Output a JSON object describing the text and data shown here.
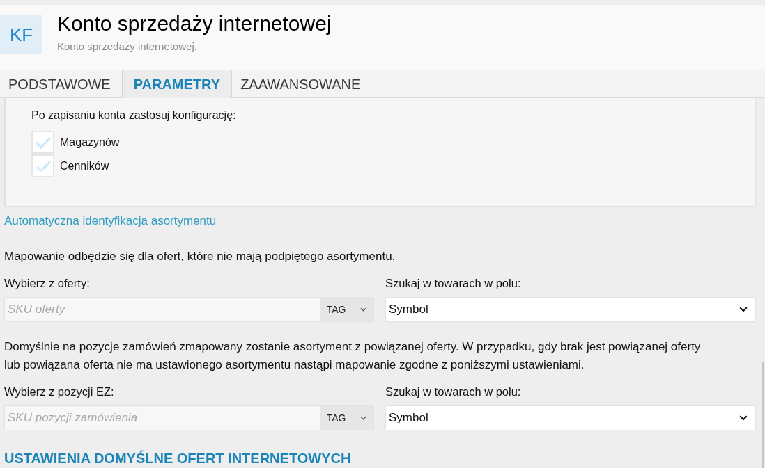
{
  "header": {
    "logo_text": "KF",
    "title": "Konto sprzedaży internetowej",
    "subtitle": "Konto sprzedaży internetowej."
  },
  "tabs": [
    {
      "label": "PODSTAWOWE",
      "selected": false
    },
    {
      "label": "PARAMETRY",
      "selected": true
    },
    {
      "label": "ZAAWANSOWANE",
      "selected": false
    }
  ],
  "config_panel": {
    "label": "Po zapisaniu konta zastosuj konfigurację:",
    "checkboxes": [
      {
        "label": "Magazynów",
        "checked": true
      },
      {
        "label": "Cenników",
        "checked": true
      }
    ]
  },
  "auto_identification": {
    "link": "Automatyczna identyfikacja asortymentu",
    "mappings": [
      {
        "note": "Mapowanie odbędzie się dla ofert, które nie mają podpiętego asortymentu.",
        "source_label": "Wybierz z oferty:",
        "source_placeholder": "SKU oferty",
        "tag_button": "TAG",
        "search_label": "Szukaj w towarach w polu:",
        "search_value": "Symbol"
      },
      {
        "note": "Domyślnie na pozycje zamówień zmapowany zostanie asortyment z powiązanej oferty. W przypadku, gdy brak jest powiązanej oferty lub powiązana oferta nie ma ustawionego asortymentu nastąpi mapowanie zgodne z poniższymi ustawieniami.",
        "source_label": "Wybierz z pozycji EZ:",
        "source_placeholder": "SKU pozycji zamówienia",
        "tag_button": "TAG",
        "search_label": "Szukaj w towarach w polu:",
        "search_value": "Symbol"
      }
    ]
  },
  "section_heading": "USTAWIENIA DOMYŚLNE OFERT INTERNETOWYCH"
}
